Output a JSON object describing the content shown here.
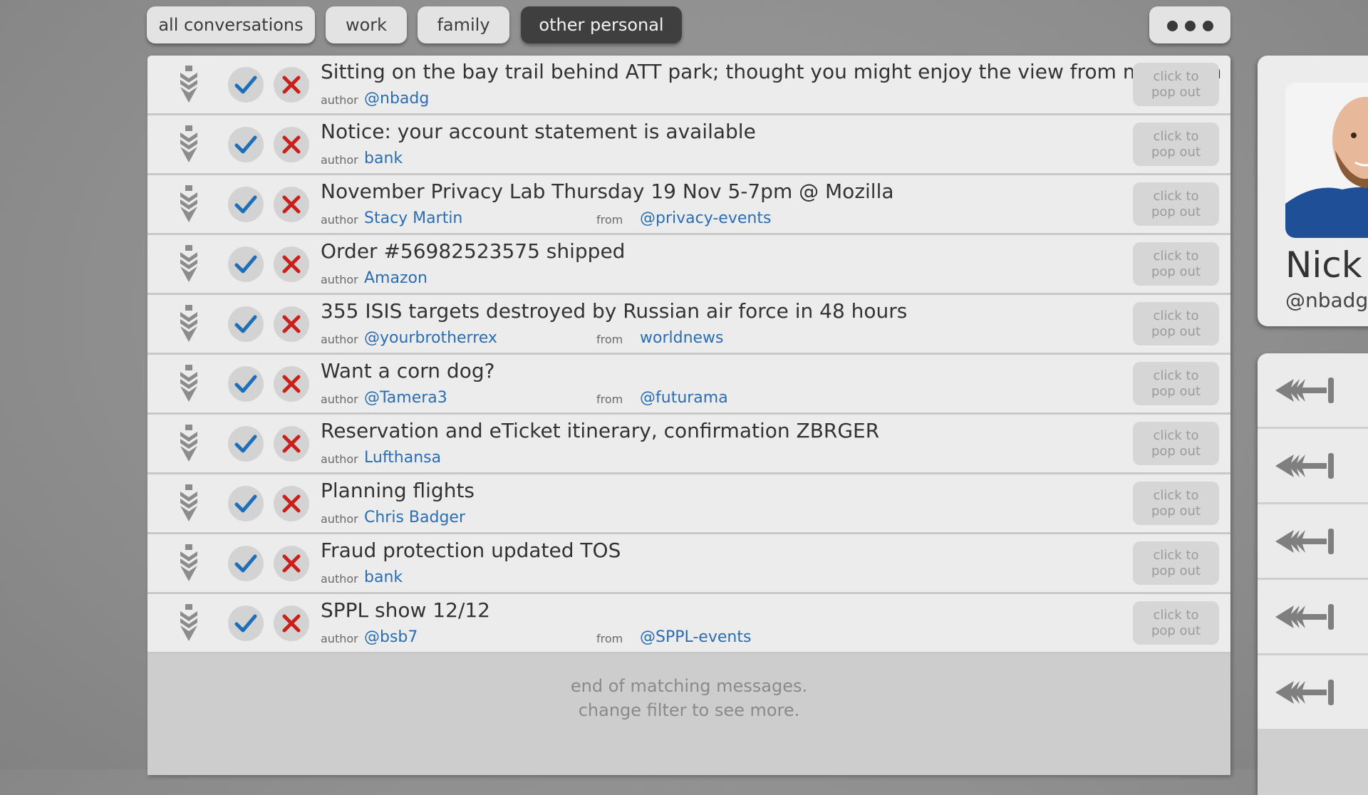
{
  "tabs": [
    {
      "label": "all conversations",
      "active": false
    },
    {
      "label": "work",
      "active": false
    },
    {
      "label": "family",
      "active": false
    },
    {
      "label": "other personal",
      "active": true
    }
  ],
  "more_icon": "ellipsis-icon",
  "labels": {
    "author": "author",
    "from": "from",
    "popout": "click to pop out"
  },
  "messages": [
    {
      "subject": "Sitting on the bay trail behind ATT park; thought you might enjoy the view from my bench",
      "author": "@nbadg",
      "from": ""
    },
    {
      "subject": "Notice: your account statement is available",
      "author": "bank",
      "from": ""
    },
    {
      "subject": "November Privacy Lab Thursday 19 Nov 5-7pm @ Mozilla",
      "author": "Stacy Martin",
      "from": "@privacy-events"
    },
    {
      "subject": "Order #56982523575 shipped",
      "author": "Amazon",
      "from": ""
    },
    {
      "subject": "355 ISIS targets destroyed by Russian air force in 48 hours",
      "author": "@yourbrotherrex",
      "from": "worldnews"
    },
    {
      "subject": "Want a corn dog?",
      "author": "@Tamera3",
      "from": "@futurama"
    },
    {
      "subject": "Reservation and eTicket itinerary, confirmation ZBRGER",
      "author": "Lufthansa",
      "from": ""
    },
    {
      "subject": "Planning flights",
      "author": "Chris Badger",
      "from": ""
    },
    {
      "subject": "Fraud protection updated TOS",
      "author": "bank",
      "from": ""
    },
    {
      "subject": "SPPL show 12/12",
      "author": "@bsb7",
      "from": "@SPPL-events"
    }
  ],
  "end_message": {
    "line1": "end of matching messages.",
    "line2": "change filter to see more."
  },
  "profile": {
    "name": "Nick B",
    "handle": "@nbadg"
  },
  "colors": {
    "check": "#1f6fb8",
    "cross": "#c9201c",
    "link": "#2a6db3",
    "active_tab": "#3f3f3f"
  },
  "action_icons": [
    "arrow-left-icon",
    "arrow-left-icon",
    "arrow-left-icon",
    "arrow-left-icon",
    "arrow-left-icon"
  ]
}
